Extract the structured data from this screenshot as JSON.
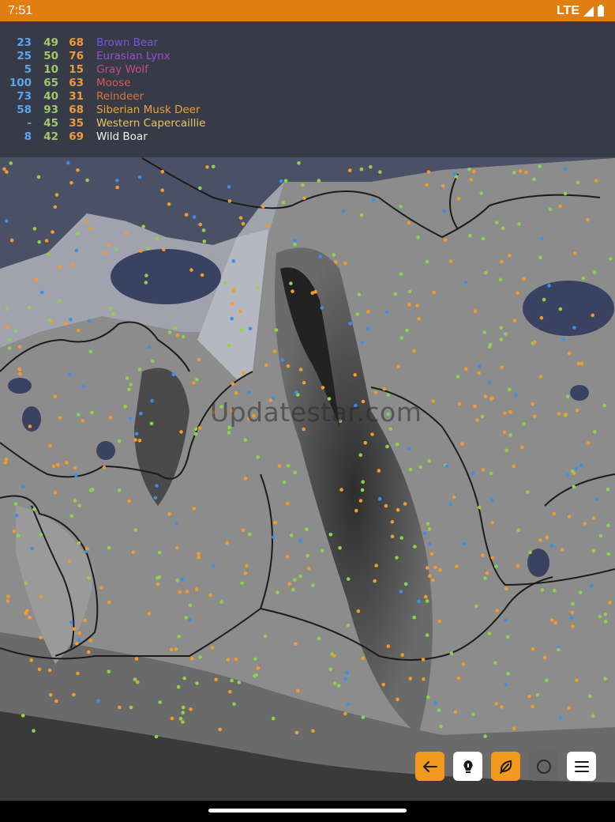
{
  "status_bar": {
    "time": "7:51",
    "network": "LTE"
  },
  "legend": [
    {
      "v1": "23",
      "v2": "49",
      "v3": "68",
      "name": "Brown Bear",
      "color": "#7b55d8"
    },
    {
      "v1": "25",
      "v2": "50",
      "v3": "76",
      "name": "Eurasian Lynx",
      "color": "#9b4fd0"
    },
    {
      "v1": "5",
      "v2": "10",
      "v3": "15",
      "name": "Gray Wolf",
      "color": "#c94a8a"
    },
    {
      "v1": "100",
      "v2": "65",
      "v3": "63",
      "name": "Moose",
      "color": "#d95a5a"
    },
    {
      "v1": "73",
      "v2": "40",
      "v3": "31",
      "name": "Reindeer",
      "color": "#e0743a"
    },
    {
      "v1": "58",
      "v2": "93",
      "v3": "68",
      "name": "Siberian Musk Deer",
      "color": "#e8a040"
    },
    {
      "v1": "-",
      "v2": "45",
      "v3": "35",
      "name": "Western Capercaillie",
      "color": "#e6c660"
    },
    {
      "v1": "8",
      "v2": "42",
      "v3": "69",
      "name": "Wild Boar",
      "color": "#f4f1e4"
    }
  ],
  "watermark": "Updatestar.com",
  "colors": {
    "blue_marker": "#3b8fe8",
    "green_marker": "#8ed24a",
    "orange_marker": "#f39a2c",
    "accent": "#f39a1e"
  },
  "toolbar": {
    "back_icon": "arrow-left-icon",
    "hint_icon": "lightbulb-icon",
    "lure_icon": "leaf-icon",
    "circle_icon": "circle-icon",
    "menu_icon": "menu-icon"
  }
}
